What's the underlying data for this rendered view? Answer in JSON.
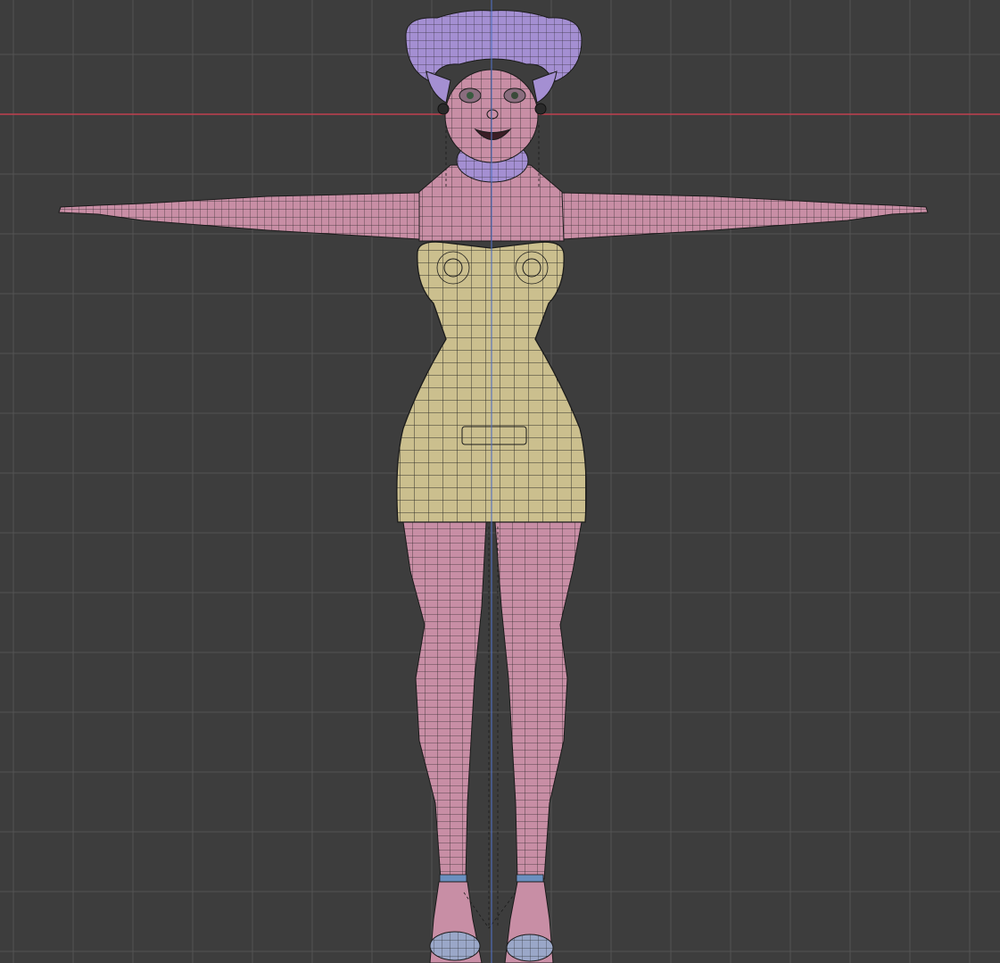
{
  "viewport": {
    "view": "front-orthographic",
    "shading": "solid-wireframe-overlay",
    "background_color": "#3d3d3d",
    "grid_color": "#545454",
    "x_axis_color": "#c0404f",
    "z_axis_color": "#4f6fc0"
  },
  "model": {
    "pose": "t-pose",
    "materials": {
      "skin": "#c88ea5",
      "dress": "#cbbf8e",
      "hair": "#a48fd2",
      "wire": "#1b1b1b",
      "strap": "#6a90c0",
      "shoe": "#9aa7c8"
    },
    "icons": [
      "wireframe-mesh-icon"
    ]
  }
}
